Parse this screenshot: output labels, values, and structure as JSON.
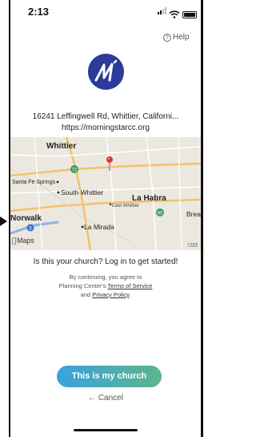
{
  "status_bar": {
    "time": "2:13"
  },
  "help": {
    "label": "Help",
    "icon": "question-circle-icon"
  },
  "church": {
    "address": "16241 Leffingwell Rd, Whittier, Californi...",
    "url": "https://morningstarcc.org",
    "logo_color": "#2b3c99"
  },
  "map": {
    "labels": {
      "whittier": "Whittier",
      "santa_fe_springs": "Santa Fe Springs",
      "south_whittier": "South Whittier",
      "la_habra": "La Habra",
      "east_whittier": "East Whittier",
      "norwalk": "Norwalk",
      "la_mirada": "La Mirada",
      "brea": "Brea",
      "maps_brand": "Maps",
      "legal": "Legal",
      "shield_72": "72",
      "shield_90": "90",
      "shield_5": "5"
    }
  },
  "prompt": {
    "question": "Is this your church? Log in to get started!",
    "terms_line1": "By continuing, you agree to",
    "terms_prefix": "Planning Center's ",
    "terms_link": "Terms of Service",
    "terms_and": "and ",
    "privacy_link": "Privacy Policy",
    "terms_end": "."
  },
  "actions": {
    "confirm_label": "This is my church",
    "cancel_label": "← Cancel"
  }
}
